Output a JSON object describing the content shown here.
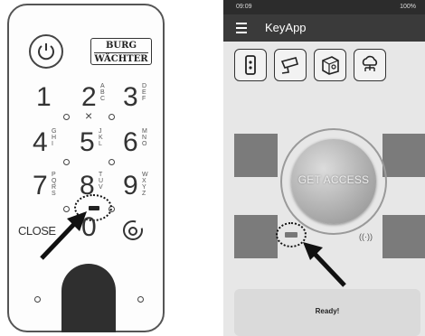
{
  "keypad": {
    "brand_line1": "BURG",
    "brand_line2": "WÄCHTER",
    "keys": [
      {
        "digit": "1",
        "letters": ""
      },
      {
        "digit": "2",
        "letters": "A\nB\nC"
      },
      {
        "digit": "3",
        "letters": "D\nE\nF"
      },
      {
        "digit": "4",
        "letters": "G\nH\nI"
      },
      {
        "digit": "5",
        "letters": "J\nK\nL"
      },
      {
        "digit": "6",
        "letters": "M\nN\nO"
      },
      {
        "digit": "7",
        "letters": "P\nQ\nR\nS"
      },
      {
        "digit": "8",
        "letters": "T\nU\nV"
      },
      {
        "digit": "9",
        "letters": "W\nX\nY\nZ"
      },
      {
        "digit": "0",
        "letters": ""
      }
    ],
    "close_label": "CLOSE",
    "cross_symbol": "×"
  },
  "phone": {
    "status_time": "09:09",
    "status_right": "100%",
    "app_title": "KeyApp",
    "tools": [
      "keypad-icon",
      "camera-icon",
      "safe-icon",
      "cloud-network-icon"
    ],
    "access_button": "GET ACCESS",
    "status_message": "Ready!",
    "wave_symbol": "((·))"
  },
  "colors": {
    "appbar": "#3a3a3a",
    "statusbar": "#2c2c2c",
    "background": "#e7e7e7",
    "pad": "#7b7b7b"
  }
}
